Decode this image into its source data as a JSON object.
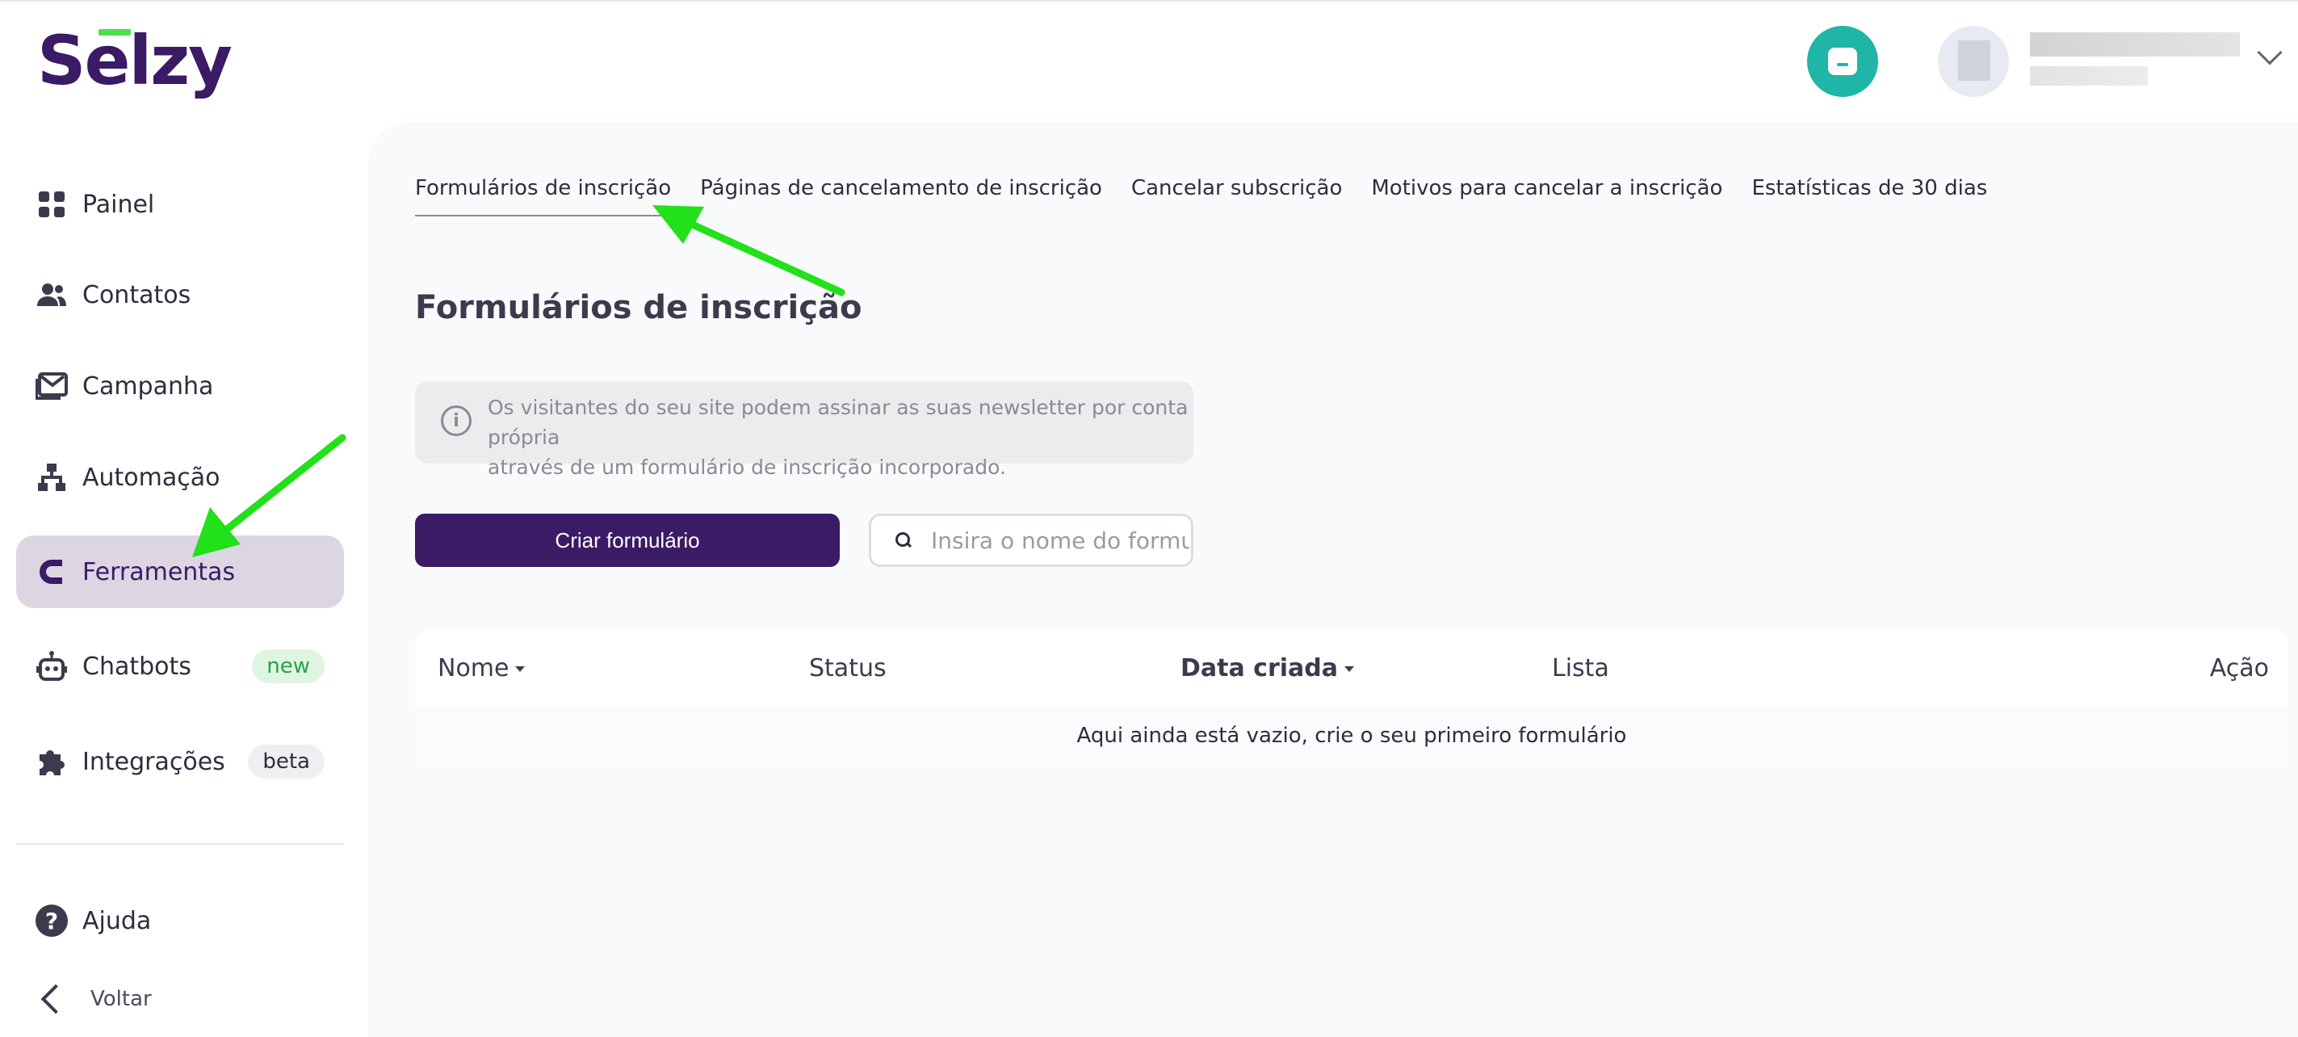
{
  "brand": {
    "logo_text": "Selzy",
    "accent": "#3b1a66",
    "logo_bar_color": "#4de04d"
  },
  "header": {
    "chat_icon": "chat-bubble-icon",
    "chat_color": "#1fb5a7",
    "user_menu_icon": "chevron-down-icon"
  },
  "sidebar": {
    "items": [
      {
        "label": "Painel",
        "icon": "grid-icon"
      },
      {
        "label": "Contatos",
        "icon": "people-icon"
      },
      {
        "label": "Campanha",
        "icon": "mail-icon"
      },
      {
        "label": "Automação",
        "icon": "hierarchy-icon"
      },
      {
        "label": "Ferramentas",
        "icon": "magnet-icon",
        "active": true
      },
      {
        "label": "Chatbots",
        "icon": "robot-icon",
        "badge": "new"
      },
      {
        "label": "Integrações",
        "icon": "puzzle-icon",
        "badge": "beta"
      }
    ],
    "help_label": "Ajuda",
    "back_label": "Voltar"
  },
  "main": {
    "tabs": [
      {
        "label": "Formulários de inscrição",
        "active": true
      },
      {
        "label": "Páginas de cancelamento de inscrição"
      },
      {
        "label": "Cancelar subscrição"
      },
      {
        "label": "Motivos para cancelar a inscrição"
      },
      {
        "label": "Estatísticas de 30 dias"
      }
    ],
    "title": "Formulários de inscrição",
    "info_text_line1": "Os visitantes do seu site podem assinar as suas newsletter por conta própria",
    "info_text_line2": "através de um formulário de inscrição incorporado.",
    "create_button": "Criar formulário",
    "search_placeholder": "Insira o nome do formulário",
    "table": {
      "columns": [
        "Nome",
        "Status",
        "Data criada",
        "Lista",
        "Ação"
      ],
      "empty_message": "Aqui ainda está vazio, crie o seu primeiro formulário"
    }
  },
  "annotations": {
    "arrow_color": "#22e01a"
  }
}
